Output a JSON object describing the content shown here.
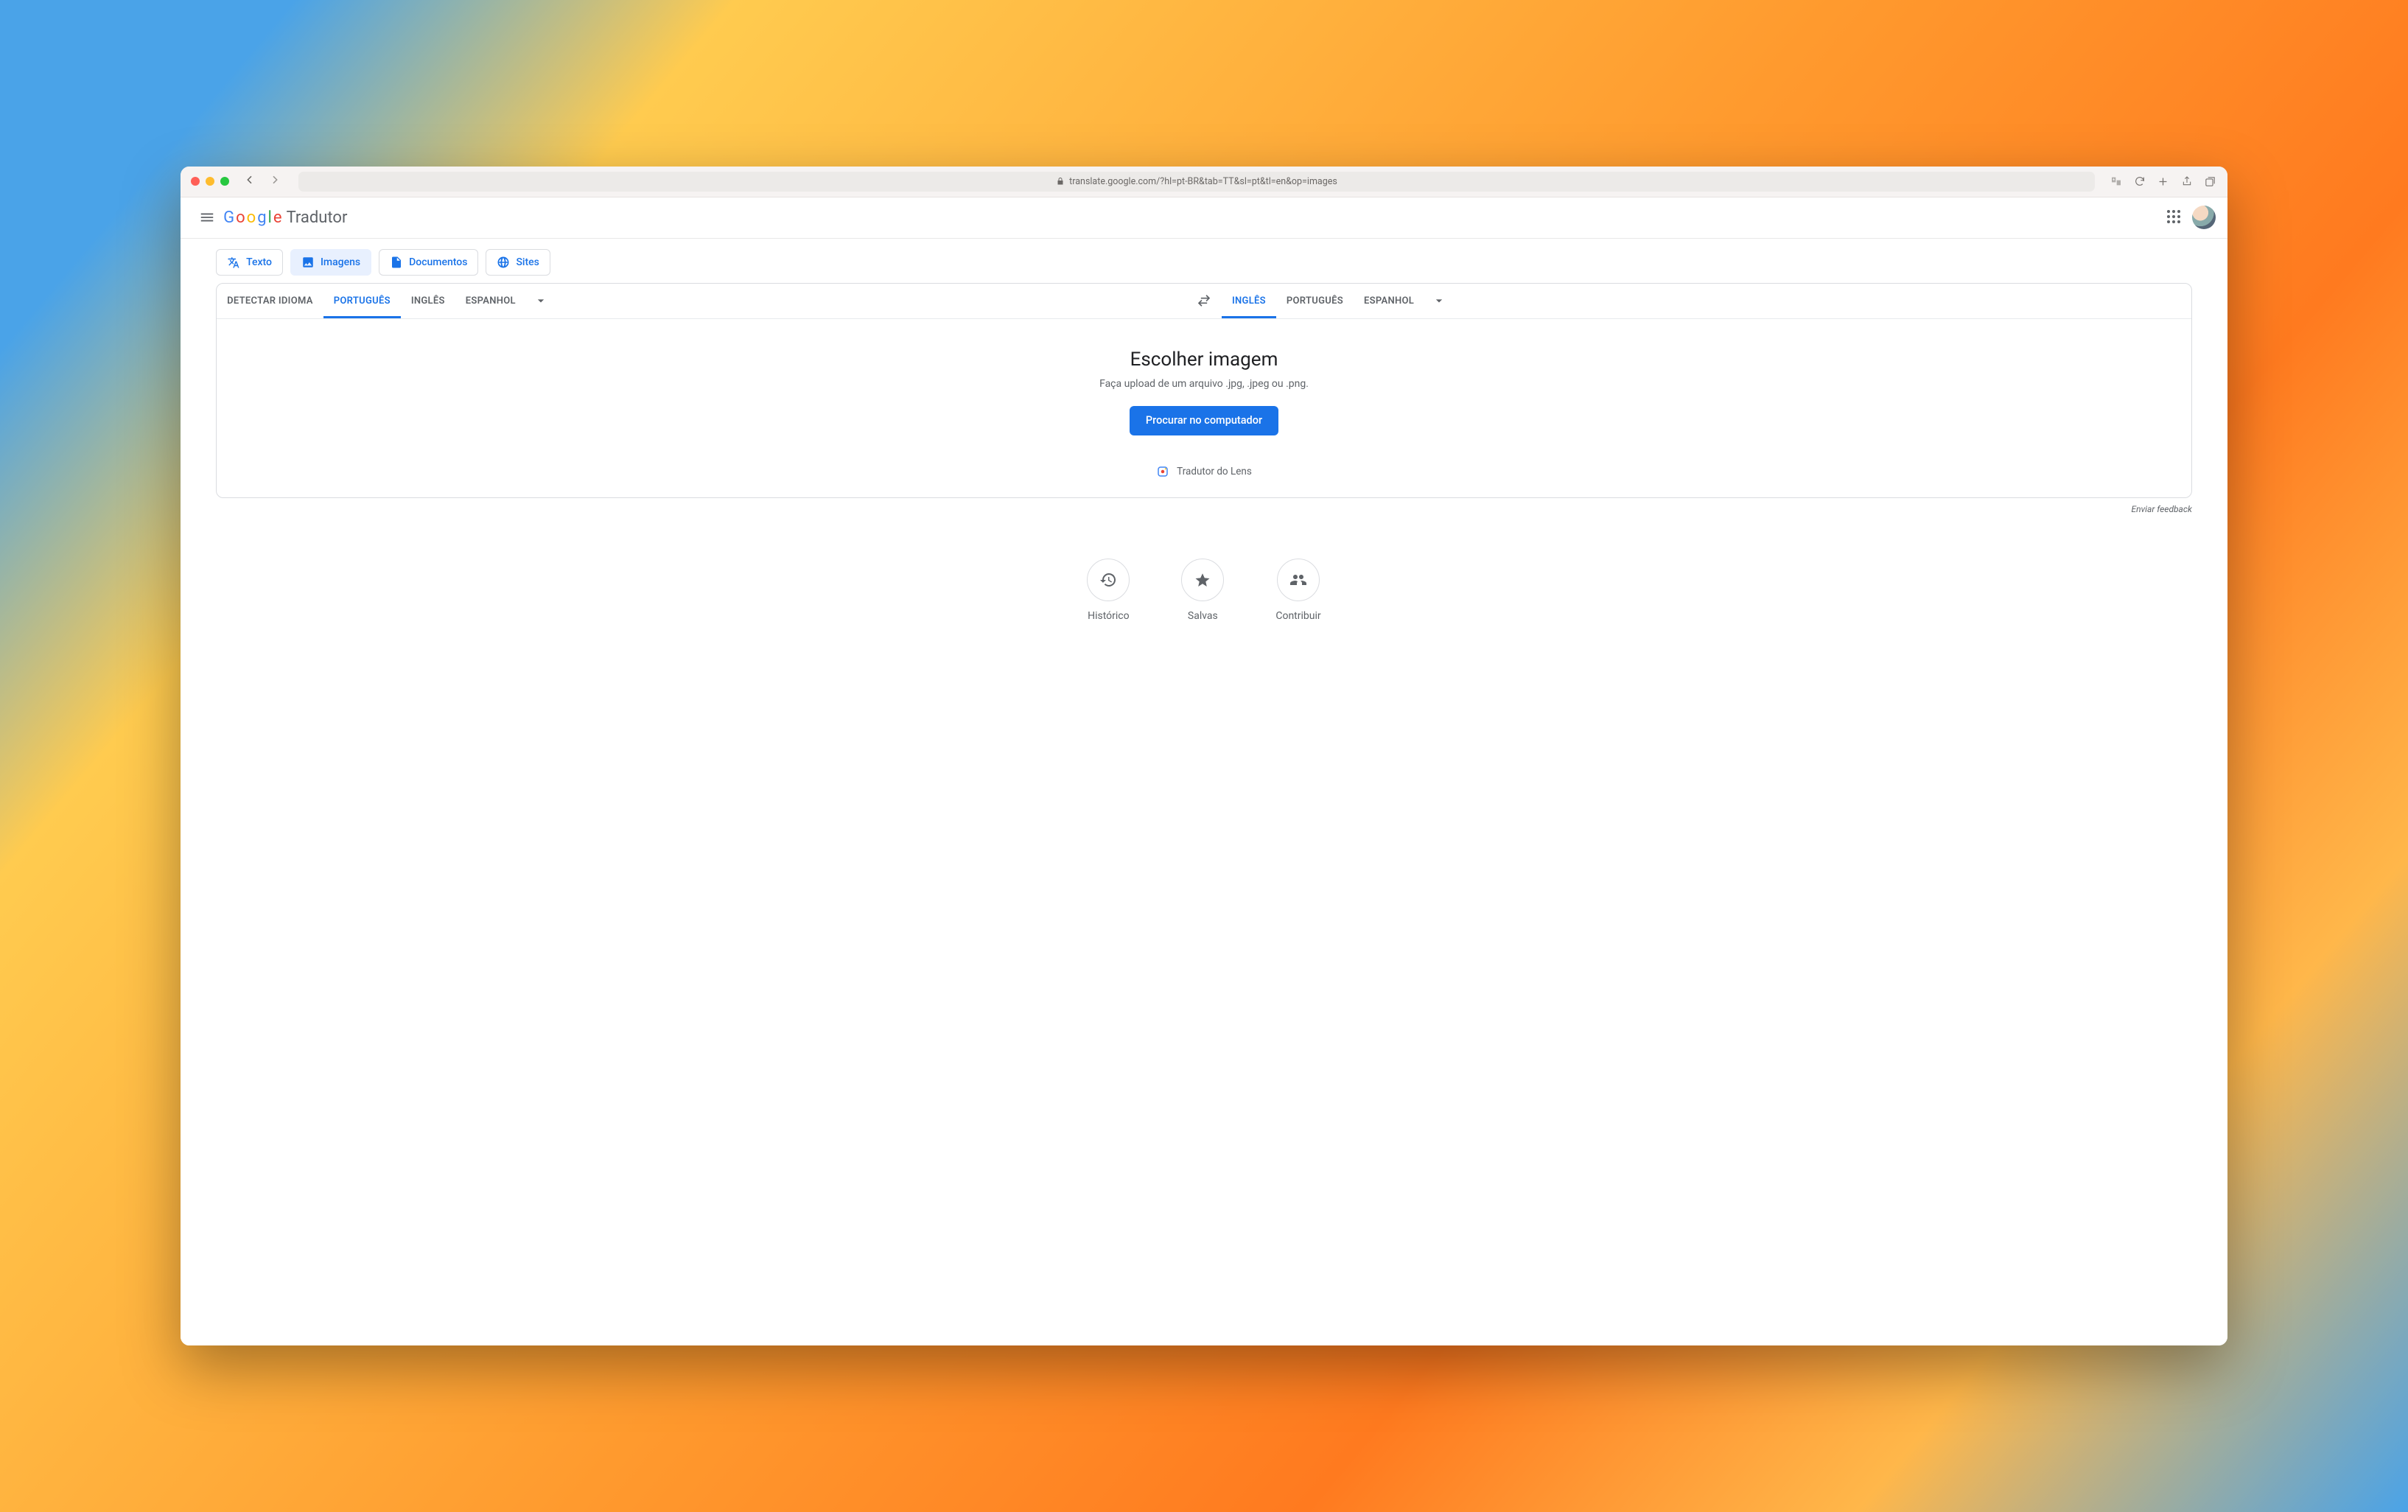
{
  "browser": {
    "url": "translate.google.com/?hl=pt-BR&tab=TT&sl=pt&tl=en&op=images"
  },
  "header": {
    "brand_sub": "Tradutor"
  },
  "modes": {
    "text": "Texto",
    "images": "Imagens",
    "documents": "Documentos",
    "sites": "Sites"
  },
  "source_langs": {
    "detect": "DETECTAR IDIOMA",
    "l1": "PORTUGUÊS",
    "l2": "INGLÊS",
    "l3": "ESPANHOL"
  },
  "target_langs": {
    "l1": "INGLÊS",
    "l2": "PORTUGUÊS",
    "l3": "ESPANHOL"
  },
  "card": {
    "title": "Escolher imagem",
    "subtitle": "Faça upload de um arquivo .jpg, .jpeg ou .png.",
    "button": "Procurar no computador",
    "lens": "Tradutor do Lens"
  },
  "feedback_label": "Enviar feedback",
  "footer": {
    "history": "Histórico",
    "saved": "Salvas",
    "contribute": "Contribuir"
  }
}
